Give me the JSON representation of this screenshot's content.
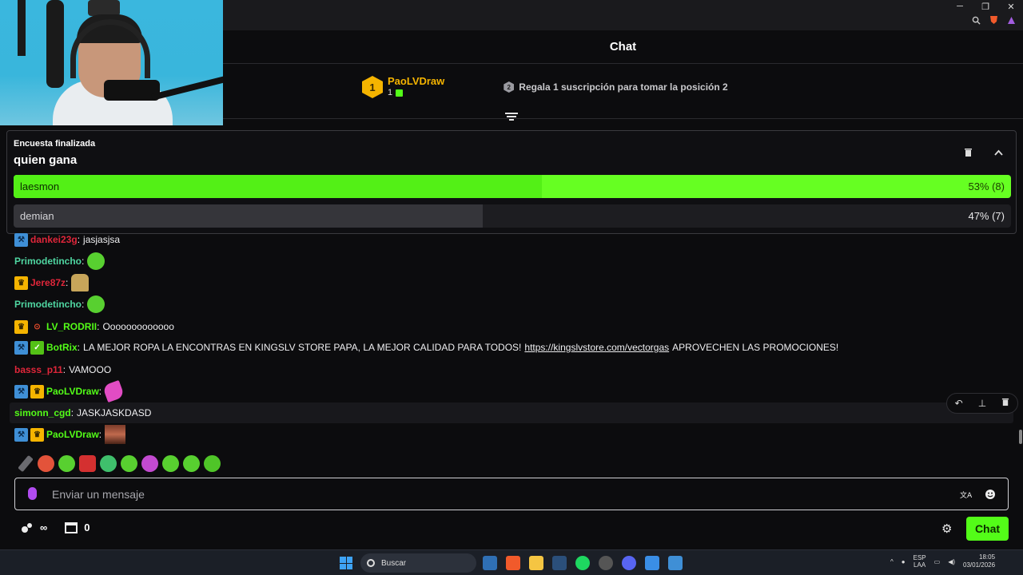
{
  "window": {
    "minimize": "─",
    "restore": "❐",
    "close": "✕"
  },
  "chat": {
    "title": "Chat"
  },
  "leaderboard": {
    "rank": "1",
    "user": "PaoLVDraw",
    "count": "1",
    "hint_rank": "2",
    "hint": "Regala 1 suscripción para tomar la posición 2"
  },
  "poll": {
    "status": "Encuesta finalizada",
    "question": "quien gana",
    "options": [
      {
        "label": "laesmon",
        "percent_text": "53% (8)",
        "percent": 53,
        "votes": 8
      },
      {
        "label": "demian",
        "percent_text": "47% (7)",
        "percent": 47,
        "votes": 7
      }
    ]
  },
  "messages": [
    {
      "user": "dankei23g",
      "sep": ":",
      "text": "jasjasjsa",
      "color": "#e0263a"
    },
    {
      "user": "Primodetincho",
      "sep": ":",
      "text": "",
      "color": "#4fd6a1"
    },
    {
      "user": "Jere87z",
      "sep": ":",
      "text": "",
      "color": "#e0263a"
    },
    {
      "user": "Primodetincho",
      "sep": ":",
      "text": "",
      "color": "#4fd6a1"
    },
    {
      "user": "LV_RODRII",
      "sep": ":",
      "text": "Ooooooooooooo",
      "color": "#53fc18"
    },
    {
      "user": "BotRix",
      "sep": ":",
      "text": "LA MEJOR ROPA LA ENCONTRAS EN KINGSLV STORE PAPA, LA MEJOR CALIDAD PARA TODOS!",
      "link": "https://kingslvstore.com/vectorgas",
      "text_after": "APROVECHEN LAS PROMOCIONES!",
      "color": "#53fc18"
    },
    {
      "user": "basss_p11",
      "sep": ":",
      "text": "VAMOOO",
      "color": "#e0263a"
    },
    {
      "user": "PaoLVDraw",
      "sep": ":",
      "text": "",
      "color": "#53fc18"
    },
    {
      "user": "simonn_cgd",
      "sep": ":",
      "text": "JASKJASKDASD",
      "color": "#53fc18"
    },
    {
      "user": "PaoLVDraw",
      "sep": ":",
      "text": "",
      "color": "#53fc18"
    }
  ],
  "input": {
    "placeholder": "Enviar un mensaje"
  },
  "footer": {
    "viewers": "∞",
    "store_count": "0",
    "chat_button": "Chat"
  },
  "taskbar": {
    "search": "Buscar",
    "lang_top": "ESP",
    "lang_bottom": "LAA",
    "time": "18:05",
    "date": "03/01/2026"
  },
  "colors": {
    "accent": "#53fc18",
    "vip": "#f5b400",
    "mod": "#3f8fd6"
  }
}
